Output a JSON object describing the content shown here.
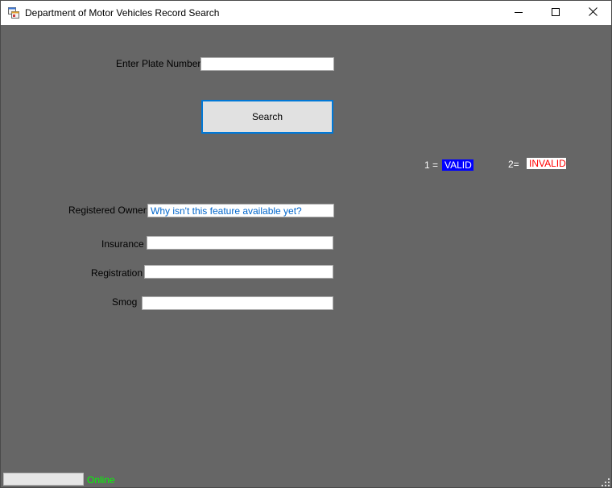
{
  "window": {
    "title": "Department of Motor Vehicles Record Search"
  },
  "form": {
    "plate_label": "Enter Plate Number:",
    "plate_value": "",
    "search_label": "Search",
    "owner_label": "Registered Owner:",
    "owner_value": "Why isn't this feature available yet?",
    "insurance_label": "Insurance",
    "insurance_value": "",
    "registration_label": "Registration",
    "registration_value": "",
    "smog_label": "Smog",
    "smog_value": ""
  },
  "legend": {
    "valid_prefix": "1 =",
    "valid_label": "VALID",
    "invalid_prefix": "2=",
    "invalid_label": "INVALID"
  },
  "status": {
    "progress": 0,
    "text": "Online"
  },
  "colors": {
    "background": "#666666",
    "valid_bg": "#0000ff",
    "invalid_fg": "#ff0000",
    "online": "#00ff00",
    "owner_text": "#0066cc",
    "button_border": "#0078d7"
  },
  "icons": {
    "app": "app-window-icon",
    "minimize": "minimize-icon",
    "maximize": "maximize-icon",
    "close": "close-icon",
    "grip": "resize-grip-icon"
  }
}
